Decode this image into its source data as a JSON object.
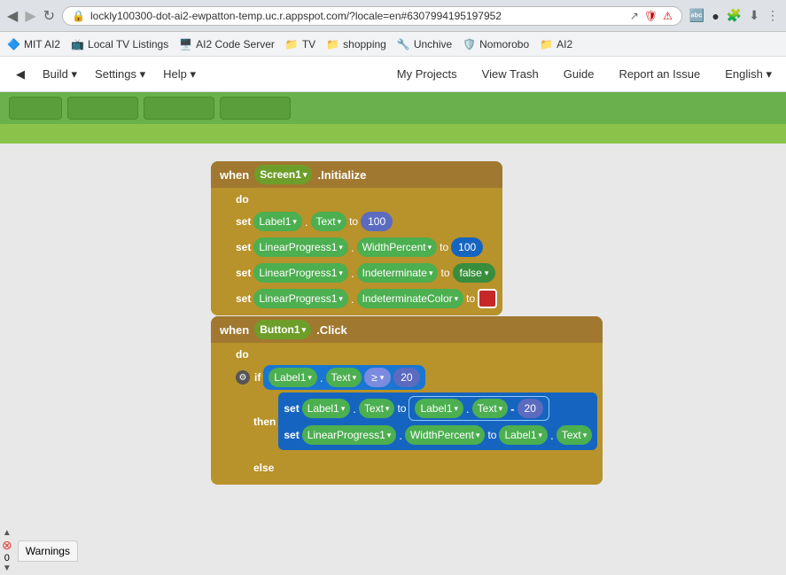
{
  "browser": {
    "address": "lockly100300-dot-ai2-ewpatton-temp.uc.r.appspot.com/?locale=en#6307994195197952",
    "icons": [
      "share",
      "shield",
      "warning"
    ]
  },
  "bookmarks": [
    {
      "label": "MIT AI2",
      "icon": "🔷"
    },
    {
      "label": "Local TV Listings",
      "icon": "📺"
    },
    {
      "label": "AI2 Code Server",
      "icon": "🖥️"
    },
    {
      "label": "TV",
      "icon": "📁"
    },
    {
      "label": "shopping",
      "icon": "📁"
    },
    {
      "label": "Unchive",
      "icon": "🔧"
    },
    {
      "label": "Nomorobo",
      "icon": "🛡️"
    },
    {
      "label": "AI2",
      "icon": "📁"
    }
  ],
  "nav": {
    "left_items": [
      "◀",
      "Build",
      "Settings",
      "Help"
    ],
    "right_items": [
      "My Projects",
      "View Trash",
      "Guide",
      "Report an Issue",
      "English ▾"
    ]
  },
  "toolbar": {
    "buttons": [
      "button1",
      "button2",
      "button3",
      "button4"
    ]
  },
  "blocks": {
    "screen_block": {
      "when_label": "when",
      "component": "Screen1",
      "event": ".Initialize",
      "do_label": "do",
      "rows": [
        {
          "set": "set",
          "component": "Label1",
          "property": "Text",
          "to": "to",
          "value": "100"
        },
        {
          "set": "set",
          "component": "LinearProgress1",
          "property": "WidthPercent",
          "to": "to",
          "value": "100"
        },
        {
          "set": "set",
          "component": "LinearProgress1",
          "property": "Indeterminate",
          "to": "to",
          "value": "false"
        },
        {
          "set": "set",
          "component": "LinearProgress1",
          "property": "IndeterminateColor",
          "to": "to",
          "value": "RED"
        }
      ]
    },
    "button_block": {
      "when_label": "when",
      "component": "Button1",
      "event": ".Click",
      "do_label": "do",
      "if_label": "if",
      "then_label": "then",
      "else_label": "else",
      "condition": {
        "component": "Label1",
        "property": "Text",
        "operator": "≥",
        "value": "20"
      },
      "then_set": {
        "component": "Label1",
        "property": "Text",
        "value_component": "Label1",
        "value_property": "Text",
        "minus": "-",
        "minus_value": "20"
      },
      "then_set2": {
        "component": "LinearProgress1",
        "property": "WidthPercent",
        "to": "to",
        "value_component": "Label1",
        "value_property": "Text"
      }
    }
  },
  "warnings": {
    "count": "0",
    "label": "Warnings"
  }
}
